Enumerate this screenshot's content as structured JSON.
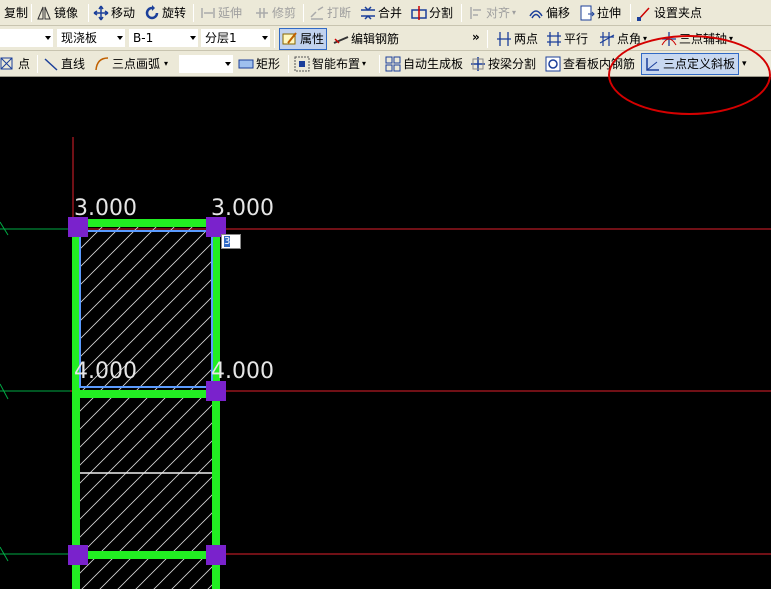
{
  "toolbar1": {
    "copy": "复制",
    "mirror": "镜像",
    "move": "移动",
    "rotate": "旋转",
    "extend": "延伸",
    "trim": "修剪",
    "break": "打断",
    "merge": "合并",
    "split": "分割",
    "align": "对齐",
    "offset": "偏移",
    "stretch": "拉伸",
    "set_grip": "设置夹点"
  },
  "toolbar2": {
    "category_value": "现浇板",
    "member_value": "B-1",
    "layer_value": "分层1",
    "properties": "属性",
    "edit_rebar": "编辑钢筋",
    "overflow": "»",
    "two_point": "两点",
    "parallel": "平行",
    "point_angle": "点角",
    "three_point_aux": "三点辅轴"
  },
  "toolbar3": {
    "point": "点",
    "line": "直线",
    "three_point_arc": "三点画弧",
    "rectangle": "矩形",
    "smart_layout": "智能布置",
    "auto_generate_slab": "自动生成板",
    "split_by_beam": "按梁分割",
    "view_slab_rebar": "查看板内钢筋",
    "three_point_slope": "三点定义斜板"
  },
  "canvas": {
    "elevations": [
      "3.000",
      "3.000",
      "4.000",
      "4.000"
    ],
    "coord_input_value": "3"
  },
  "colors": {
    "toolbar_bg": "#ece9d8",
    "canvas_bg": "#000000",
    "slab_edge": "#22ee22",
    "slab_outline": "#5b9bff",
    "vertex": "#7a22cc",
    "axis_line": "#e0202c",
    "annotation": "#d40000"
  }
}
